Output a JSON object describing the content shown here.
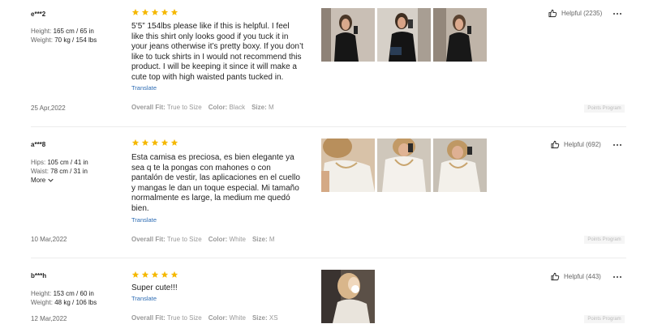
{
  "reviews": [
    {
      "user": "e***2",
      "measurements": [
        {
          "label": "Height:",
          "value": "165 cm / 65 in"
        },
        {
          "label": "Weight:",
          "value": "70 kg / 154 lbs"
        }
      ],
      "more": "",
      "rating": 5,
      "text": "5’5” 154lbs please like if this is helpful. I feel like this shirt only looks good if you tuck it in your jeans otherwise it’s pretty boxy. If you don’t like to tuck shirts in I would not recommend this product. I will be keeping it since it will make a cute top with high waisted pants tucked in.",
      "translate": "Translate",
      "date": "25 Apr,2022",
      "fit_label": "Overall Fit:",
      "fit_value": "True to Size",
      "color_label": "Color:",
      "color_value": "Black",
      "size_label": "Size:",
      "size_value": "M",
      "helpful": "Helpful (2235)",
      "points": "Points Program",
      "photo_count": 3
    },
    {
      "user": "a***8",
      "measurements": [
        {
          "label": "Hips:",
          "value": "105 cm / 41 in"
        },
        {
          "label": "Waist:",
          "value": "78 cm / 31 in"
        }
      ],
      "more": "More",
      "rating": 5,
      "text": "Esta camisa es preciosa, es bien elegante ya sea q te la pongas con mahones o con pantalón de vestir, las aplicaciones en el cuello y mangas le dan un toque especial. Mi tamaño normalmente es large, la medium me quedó bien.",
      "translate": "Translate",
      "date": "10 Mar,2022",
      "fit_label": "Overall Fit:",
      "fit_value": "True to Size",
      "color_label": "Color:",
      "color_value": "White",
      "size_label": "Size:",
      "size_value": "M",
      "helpful": "Helpful (692)",
      "points": "Points Program",
      "photo_count": 3
    },
    {
      "user": "b***h",
      "measurements": [
        {
          "label": "Height:",
          "value": "153 cm / 60 in"
        },
        {
          "label": "Weight:",
          "value": "48 kg / 106 lbs"
        }
      ],
      "more": "",
      "rating": 5,
      "text": "Super cute!!!",
      "translate": "Translate",
      "date": "12 Mar,2022",
      "fit_label": "Overall Fit:",
      "fit_value": "True to Size",
      "color_label": "Color:",
      "color_value": "White",
      "size_label": "Size:",
      "size_value": "XS",
      "helpful": "Helpful (443)",
      "points": "Points Program",
      "photo_count": 1
    }
  ],
  "colors": {
    "star": "#f5b800",
    "translate_link": "#2d6cb4",
    "divider": "#ececec"
  },
  "icons": {
    "star": "star-icon",
    "helpful": "thumbs-up-icon",
    "more_actions": "more-dots-icon",
    "more_expand": "chevron-down-icon"
  }
}
